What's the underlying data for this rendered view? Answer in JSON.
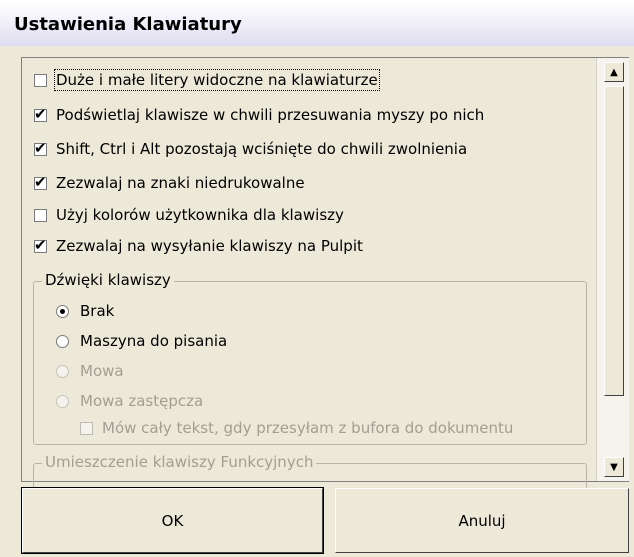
{
  "window": {
    "title": "Ustawienia Klawiatury"
  },
  "options": [
    {
      "label": "Duże i małe litery widoczne na klawiaturze",
      "checked": false
    },
    {
      "label": "Podświetlaj klawisze w chwili przesuwania myszy po nich",
      "checked": true
    },
    {
      "label": "Shift, Ctrl i Alt pozostają wciśnięte do chwili zwolnienia",
      "checked": true
    },
    {
      "label": "Zezwalaj na znaki niedrukowalne",
      "checked": true
    },
    {
      "label": "Użyj kolorów użytkownika dla klawiszy",
      "checked": false
    },
    {
      "label": "Zezwalaj na wysyłanie klawiszy na Pulpit",
      "checked": true
    }
  ],
  "sounds_group": {
    "title": "Dźwięki klawiszy",
    "options": [
      {
        "label": "Brak",
        "selected": true,
        "enabled": true
      },
      {
        "label": "Maszyna do pisania",
        "selected": false,
        "enabled": true
      },
      {
        "label": "Mowa",
        "selected": false,
        "enabled": false
      },
      {
        "label": "Mowa zastępcza",
        "selected": false,
        "enabled": false
      }
    ],
    "sub_option": {
      "label": "Mów cały tekst, gdy przesyłam z bufora do dokumentu",
      "checked": false,
      "enabled": false
    }
  },
  "function_keys_group": {
    "title": "Umieszczenie klawiszy Funkcyjnych"
  },
  "buttons": {
    "ok": "OK",
    "cancel": "Anuluj"
  },
  "icons": {
    "scroll_up": "scroll-up-arrow-icon",
    "scroll_down": "scroll-down-arrow-icon"
  }
}
